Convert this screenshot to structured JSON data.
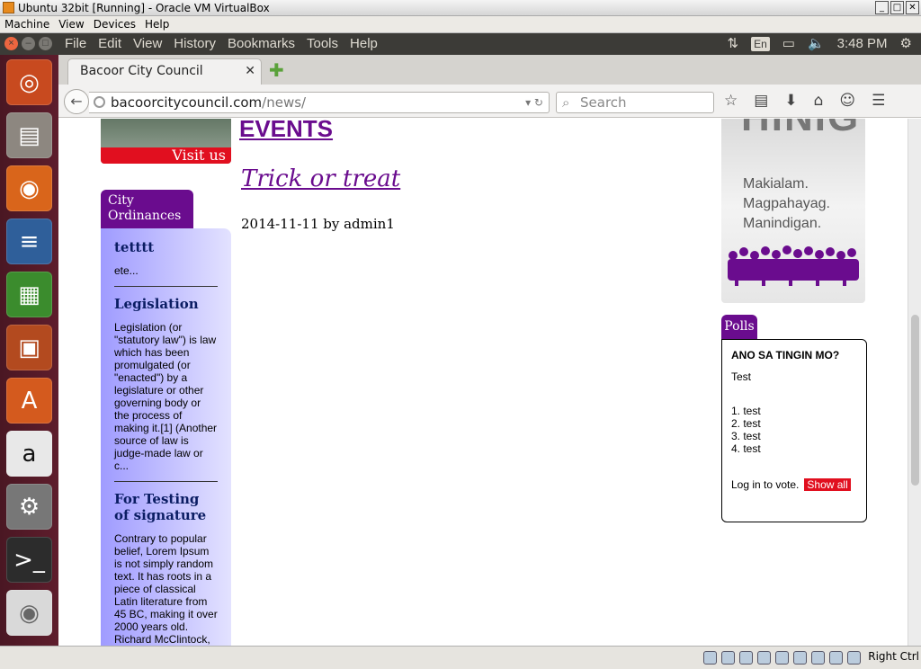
{
  "vbox": {
    "title": "Ubuntu 32bit [Running] - Oracle VM VirtualBox",
    "menu": [
      "Machine",
      "View",
      "Devices",
      "Help"
    ],
    "host_key": "Right Ctrl"
  },
  "panel": {
    "menus": [
      "File",
      "Edit",
      "View",
      "History",
      "Bookmarks",
      "Tools",
      "Help"
    ],
    "lang": "En",
    "clock": "3:48 PM"
  },
  "launcher": {
    "items": [
      "ubuntu-dash",
      "files",
      "firefox",
      "writer",
      "calc",
      "impress",
      "software-center",
      "amazon",
      "system-settings",
      "terminal",
      "dvd"
    ]
  },
  "browser": {
    "tab_title": "Bacoor City Council",
    "url_host": "bacoorcitycouncil.com",
    "url_path": "/news/",
    "search_placeholder": "Search"
  },
  "page": {
    "visit_label": "Visit us",
    "sidebar_title": "City Ordinances",
    "sidebar_items": [
      {
        "title": "tetttt",
        "text": "ete..."
      },
      {
        "title": "Legislation",
        "text": "Legislation (or \"statutory law\") is law which has been promulgated (or \"enacted\") by a legislature or other governing body or the process of making it.[1] (Another source of law is judge-made law or c..."
      },
      {
        "title": "For Testing of signature",
        "text": "Contrary to popular belief, Lorem Ipsum is not simply random text. It has roots in a piece of classical Latin literature from 45 BC, making it over 2000 years old. Richard McClintock,"
      }
    ],
    "events_heading": "EVENTS",
    "post_title": "Trick or treat",
    "post_meta": "2014-11-11 by admin1",
    "ad_big": "HINIG",
    "ad_lines": [
      "Makialam.",
      "Magpahayag.",
      "Manindigan."
    ],
    "polls_title": "Polls",
    "poll": {
      "question": "ANO SA TINGIN MO?",
      "text": "Test",
      "options": [
        "1. test",
        "2. test",
        "3. test",
        "4. test"
      ],
      "login_text": "Log in to vote.",
      "show_all": "Show all"
    }
  }
}
